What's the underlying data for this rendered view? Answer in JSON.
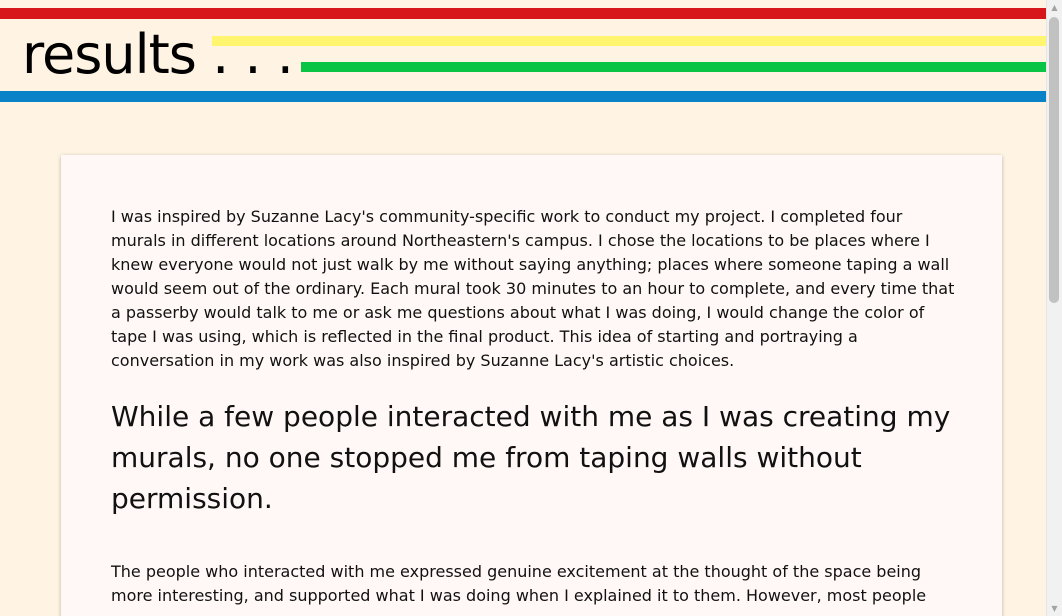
{
  "header": {
    "title": "results . . .",
    "stripe_colors": {
      "red": "#d6161b",
      "yellow": "#fff56f",
      "green": "#0ac545",
      "blue": "#0a82c7"
    }
  },
  "main": {
    "paragraph_1": "I was inspired by Suzanne Lacy's community-specific work to conduct my project. I completed four murals in different locations around Northeastern's campus. I chose the locations to be places where I knew everyone would not just walk by me without saying anything; places where someone taping a wall would seem out of the ordinary. Each mural took 30 minutes to an hour to complete, and every time that a passerby would talk to me or ask me questions about what I was doing, I would change the color of tape I was using, which is reflected in the final product. This idea of starting and portraying a conversation in my work was also inspired by Suzanne Lacy's artistic choices.",
    "pull_quote": "While a few people interacted with me as I was creating my murals, no one stopped me from taping walls without permission.",
    "paragraph_2": "The people who interacted with me expressed genuine excitement at the thought of the space being more interesting, and supported what I was doing when I explained it to them. However, most people"
  },
  "scrollbar": {
    "up_icon": "triangle-up",
    "down_icon": "triangle-down"
  }
}
